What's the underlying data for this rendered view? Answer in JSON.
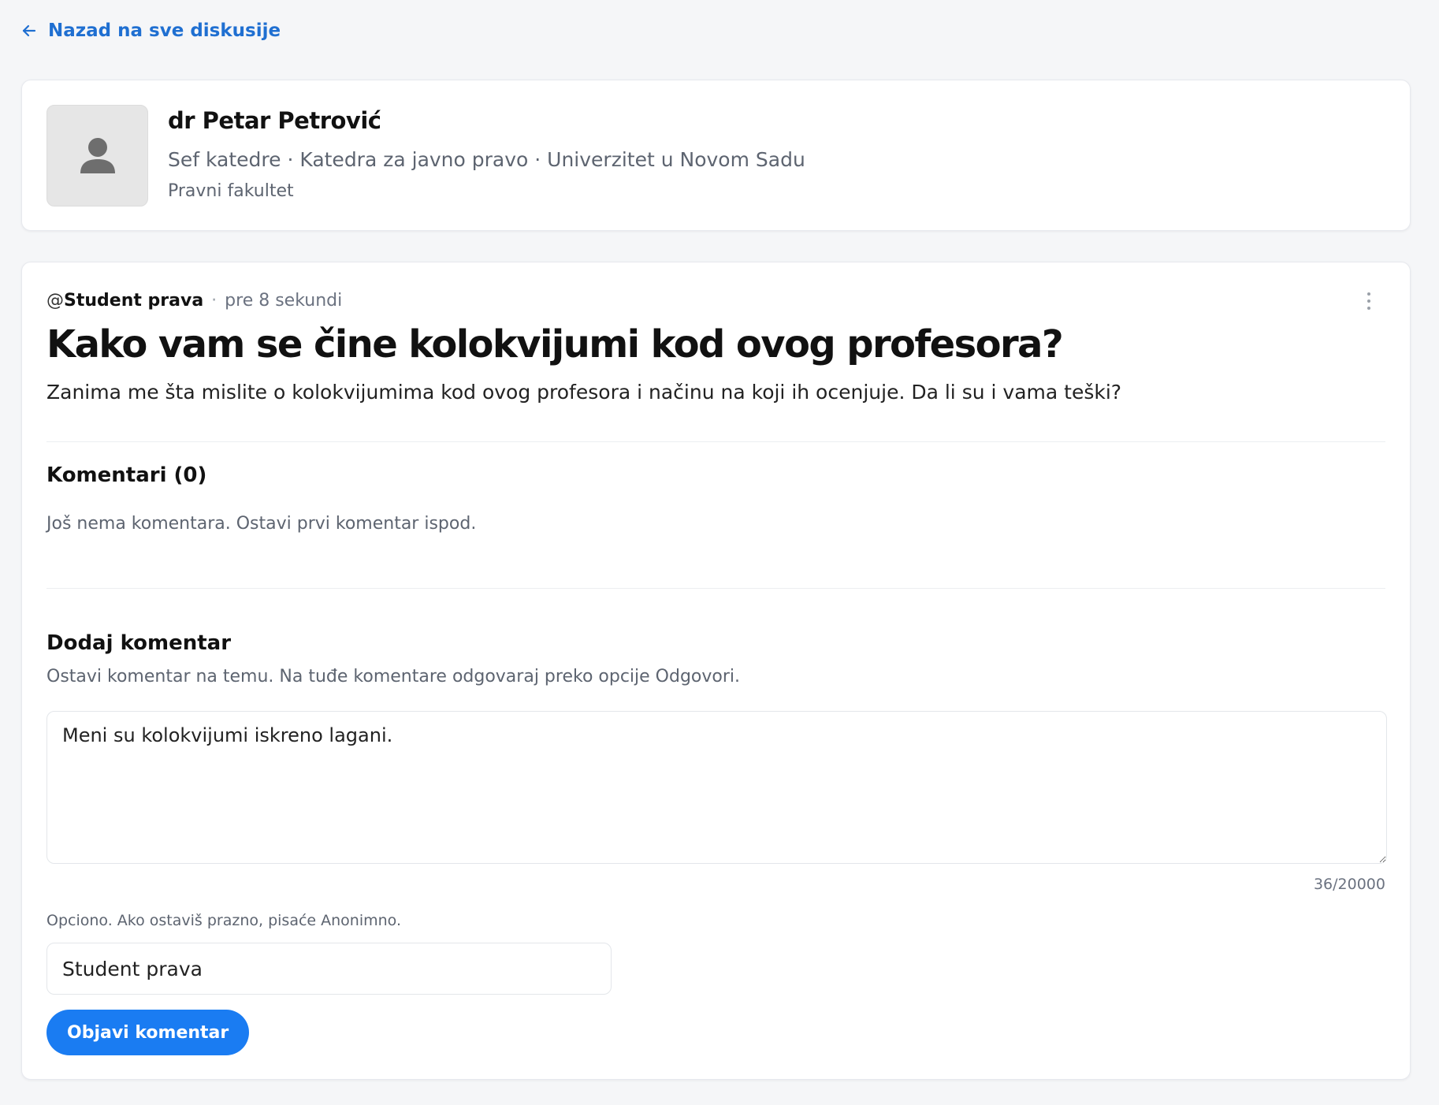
{
  "nav": {
    "back_label": "Nazad na sve diskusije",
    "back_icon": "arrow-left-icon"
  },
  "profile": {
    "avatar_icon": "user-icon",
    "name": "dr Petar Petrović",
    "meta": "Sef katedre · Katedra za javno pravo · Univerzitet u Novom Sadu",
    "faculty": "Pravni fakultet"
  },
  "post": {
    "at_symbol": "@",
    "author": "Student prava",
    "separator": "·",
    "time": "pre 8 sekundi",
    "more_icon": "more-vertical-icon",
    "title": "Kako vam se čine kolokvijumi kod ovog  profesora?",
    "body": "Zanima me šta mislite o kolokvijumima kod ovog profesora i načinu na koji ih ocenjuje. Da li su i vama teški?"
  },
  "comments": {
    "title": "Komentari (0)",
    "empty_message": "Još nema komentara. Ostavi prvi komentar ispod."
  },
  "add_comment": {
    "title": "Dodaj komentar",
    "subtitle": "Ostavi komentar na temu. Na tuđe komentare odgovaraj preko opcije Odgovori.",
    "comment_value": "Meni su kolokvijumi iskreno lagani.",
    "char_count": "36/20000",
    "name_hint": "Opciono. Ako ostaviš prazno, pisaće Anonimno.",
    "name_value": "Student prava",
    "submit_label": "Objavi komentar"
  },
  "colors": {
    "accent": "#1a7cf2",
    "link": "#1f6fd1",
    "background": "#f5f6f8",
    "muted_text": "#5d6470"
  }
}
